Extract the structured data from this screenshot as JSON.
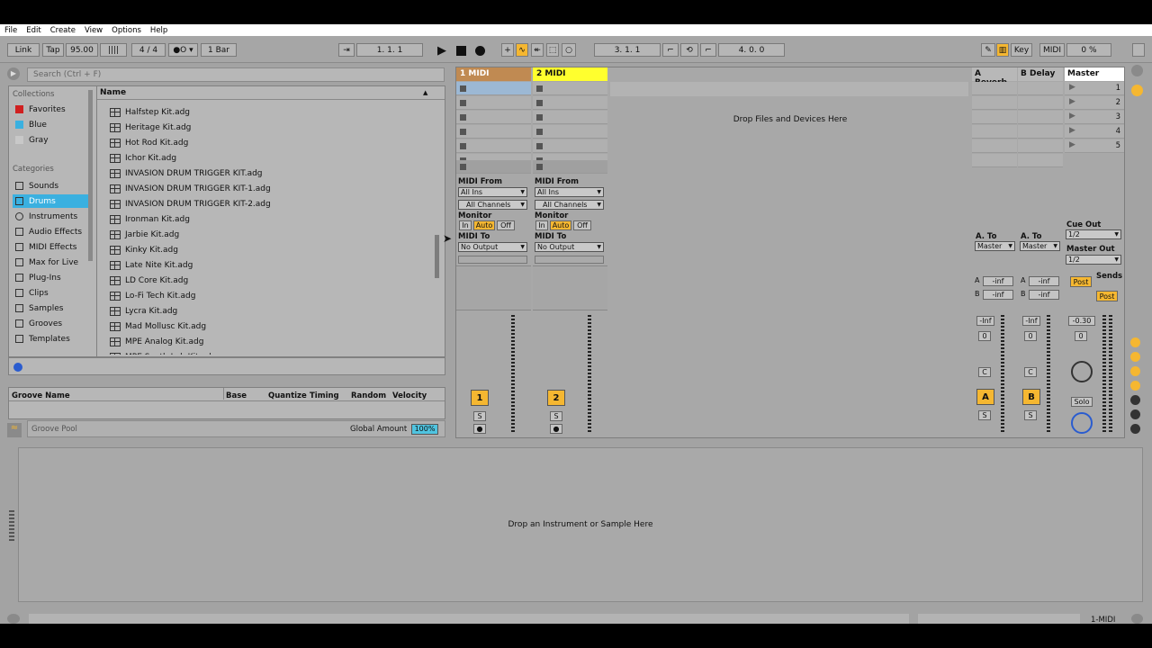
{
  "menu": [
    "File",
    "Edit",
    "Create",
    "View",
    "Options",
    "Help"
  ],
  "transport": {
    "link": "Link",
    "tap": "Tap",
    "tempo": "95.00",
    "signature": "4 / 4",
    "quantize": "1 Bar",
    "position": "1.   1.   1",
    "position2": "3.   1.   1",
    "position3": "4.   0.   0",
    "key": "Key",
    "midi": "MIDI",
    "cpu": "0 %"
  },
  "browser": {
    "search_placeholder": "Search (Ctrl + F)",
    "collections_header": "Collections",
    "collections": [
      {
        "label": "Favorites",
        "color": "#d02020"
      },
      {
        "label": "Blue",
        "color": "#3ab0e0"
      },
      {
        "label": "Gray",
        "color": "#c8c8c8"
      }
    ],
    "categories_header": "Categories",
    "categories": [
      "Sounds",
      "Drums",
      "Instruments",
      "Audio Effects",
      "MIDI Effects",
      "Max for Live",
      "Plug-Ins",
      "Clips",
      "Samples",
      "Grooves",
      "Templates"
    ],
    "name_header": "Name",
    "files": [
      "Halfstep Kit.adg",
      "Heritage Kit.adg",
      "Hot Rod Kit.adg",
      "Ichor Kit.adg",
      "INVASION DRUM TRIGGER KIT.adg",
      "INVASION DRUM TRIGGER KIT-1.adg",
      "INVASION DRUM TRIGGER KIT-2.adg",
      "Ironman Kit.adg",
      "Jarbie Kit.adg",
      "Kinky Kit.adg",
      "Late Nite Kit.adg",
      "LD Core Kit.adg",
      "Lo-Fi Tech Kit.adg",
      "Lycra Kit.adg",
      "Mad Mollusc Kit.adg",
      "MPE Analog Kit.adg",
      "MPE Synth Lab Kit.adg"
    ]
  },
  "groove": {
    "columns": [
      "Groove Name",
      "Base",
      "Quantize",
      "Timing",
      "Random",
      "Velocity"
    ],
    "pool_label": "Groove Pool",
    "global_amount_label": "Global Amount",
    "global_amount": "100%"
  },
  "tracks": [
    {
      "name": "1 MIDI",
      "color": "#c08a52",
      "num": "1"
    },
    {
      "name": "2 MIDI",
      "color": "#ffff2e",
      "num": "2"
    }
  ],
  "io": {
    "midi_from": "MIDI From",
    "all_ins": "All Ins",
    "all_channels": "All Channels",
    "monitor": "Monitor",
    "in": "In",
    "auto": "Auto",
    "off": "Off",
    "midi_to": "MIDI To",
    "no_output": "No Output"
  },
  "session": {
    "drop_files": "Drop Files and Devices Here"
  },
  "returns": [
    {
      "name": "A Reverb",
      "letter": "A"
    },
    {
      "name": "B Delay",
      "letter": "B"
    }
  ],
  "master": {
    "name": "Master",
    "scenes": [
      "1",
      "2",
      "3",
      "4",
      "5"
    ],
    "cue_out": "Cue Out",
    "cue_val": "1/2",
    "master_out": "Master Out",
    "master_val": "1/2",
    "sends": "Sends",
    "post": "Post",
    "vol": "-0.30",
    "pan": "0",
    "solo": "Solo"
  },
  "return_io": {
    "a_to": "A. To",
    "master": "Master",
    "inf": "-inf",
    "vol": "-Inf",
    "pan": "0",
    "s": "S",
    "c": "C",
    "a": "A",
    "b": "B"
  },
  "detail": {
    "drop_instrument": "Drop an Instrument or Sample Here"
  },
  "status": {
    "track_label": "1-MIDI"
  }
}
